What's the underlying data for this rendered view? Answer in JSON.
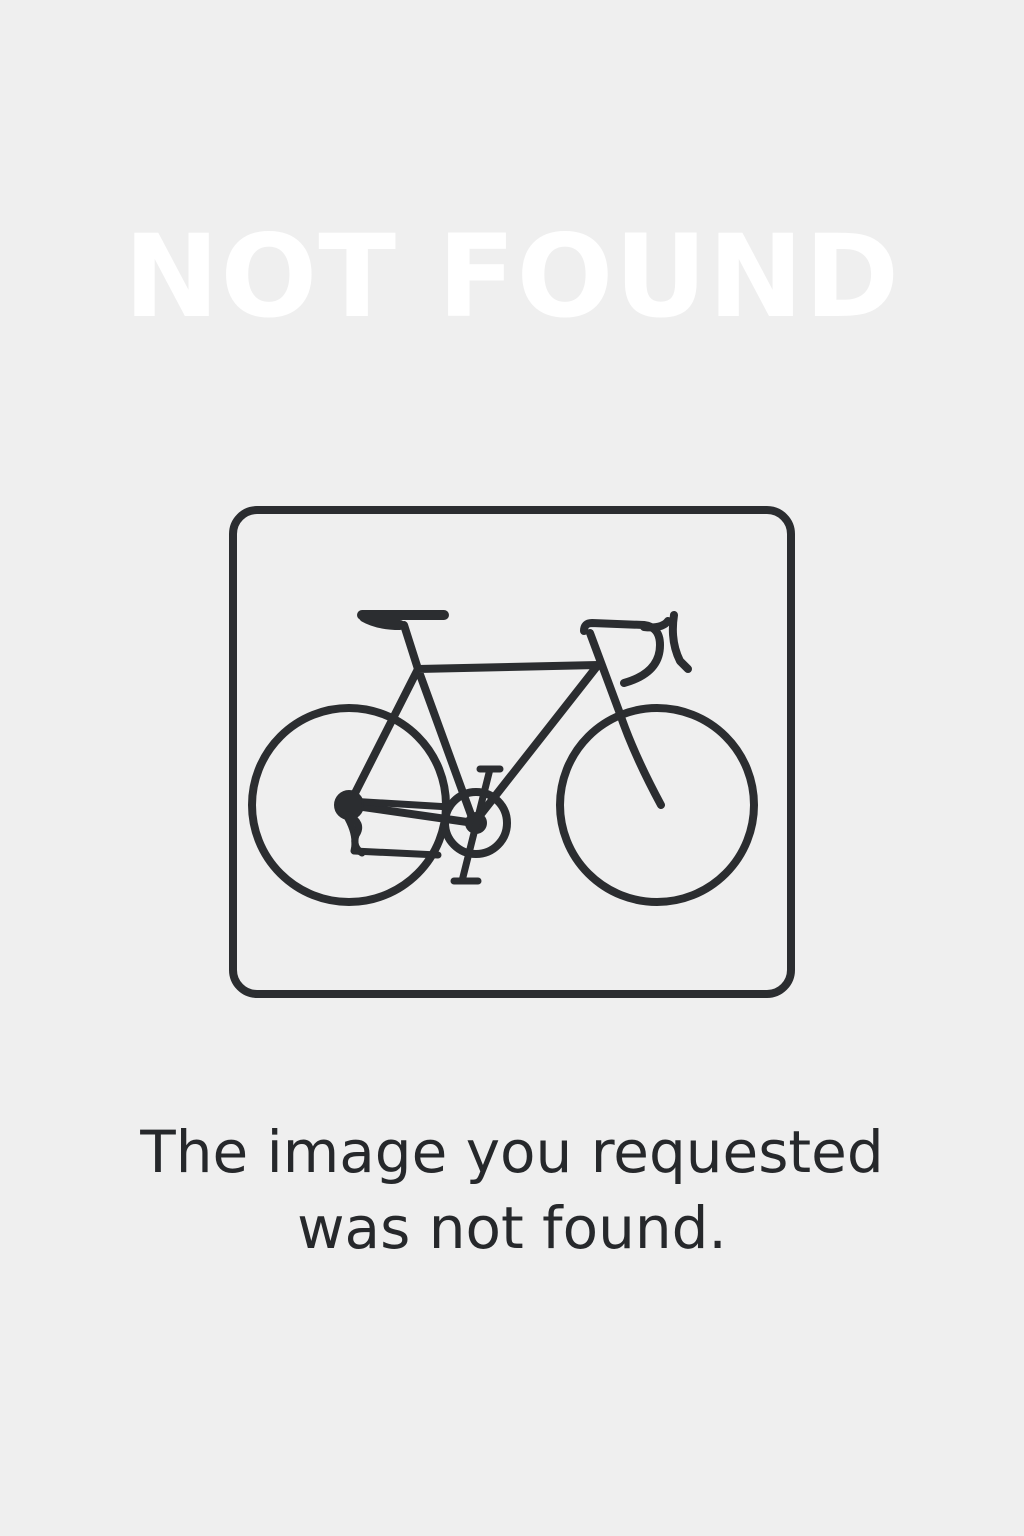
{
  "heading": "NOT FOUND",
  "icon": "bicycle-icon",
  "message": {
    "line1": "The image you requested",
    "line2": "was not found."
  },
  "colors": {
    "background": "#efefef",
    "heading": "#ffffff",
    "icon_stroke": "#2b2d30",
    "text": "#26282b"
  }
}
